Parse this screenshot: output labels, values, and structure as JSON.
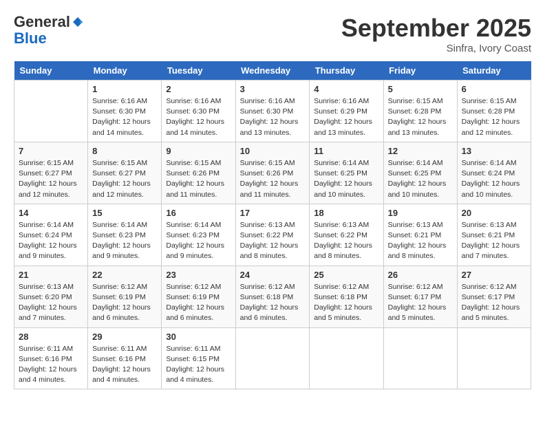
{
  "header": {
    "logo_general": "General",
    "logo_blue": "Blue",
    "month_title": "September 2025",
    "subtitle": "Sinfra, Ivory Coast"
  },
  "weekdays": [
    "Sunday",
    "Monday",
    "Tuesday",
    "Wednesday",
    "Thursday",
    "Friday",
    "Saturday"
  ],
  "weeks": [
    [
      {
        "day": "",
        "info": ""
      },
      {
        "day": "1",
        "info": "Sunrise: 6:16 AM\nSunset: 6:30 PM\nDaylight: 12 hours\nand 14 minutes."
      },
      {
        "day": "2",
        "info": "Sunrise: 6:16 AM\nSunset: 6:30 PM\nDaylight: 12 hours\nand 14 minutes."
      },
      {
        "day": "3",
        "info": "Sunrise: 6:16 AM\nSunset: 6:30 PM\nDaylight: 12 hours\nand 13 minutes."
      },
      {
        "day": "4",
        "info": "Sunrise: 6:16 AM\nSunset: 6:29 PM\nDaylight: 12 hours\nand 13 minutes."
      },
      {
        "day": "5",
        "info": "Sunrise: 6:15 AM\nSunset: 6:28 PM\nDaylight: 12 hours\nand 13 minutes."
      },
      {
        "day": "6",
        "info": "Sunrise: 6:15 AM\nSunset: 6:28 PM\nDaylight: 12 hours\nand 12 minutes."
      }
    ],
    [
      {
        "day": "7",
        "info": "Sunrise: 6:15 AM\nSunset: 6:27 PM\nDaylight: 12 hours\nand 12 minutes."
      },
      {
        "day": "8",
        "info": "Sunrise: 6:15 AM\nSunset: 6:27 PM\nDaylight: 12 hours\nand 12 minutes."
      },
      {
        "day": "9",
        "info": "Sunrise: 6:15 AM\nSunset: 6:26 PM\nDaylight: 12 hours\nand 11 minutes."
      },
      {
        "day": "10",
        "info": "Sunrise: 6:15 AM\nSunset: 6:26 PM\nDaylight: 12 hours\nand 11 minutes."
      },
      {
        "day": "11",
        "info": "Sunrise: 6:14 AM\nSunset: 6:25 PM\nDaylight: 12 hours\nand 10 minutes."
      },
      {
        "day": "12",
        "info": "Sunrise: 6:14 AM\nSunset: 6:25 PM\nDaylight: 12 hours\nand 10 minutes."
      },
      {
        "day": "13",
        "info": "Sunrise: 6:14 AM\nSunset: 6:24 PM\nDaylight: 12 hours\nand 10 minutes."
      }
    ],
    [
      {
        "day": "14",
        "info": "Sunrise: 6:14 AM\nSunset: 6:24 PM\nDaylight: 12 hours\nand 9 minutes."
      },
      {
        "day": "15",
        "info": "Sunrise: 6:14 AM\nSunset: 6:23 PM\nDaylight: 12 hours\nand 9 minutes."
      },
      {
        "day": "16",
        "info": "Sunrise: 6:14 AM\nSunset: 6:23 PM\nDaylight: 12 hours\nand 9 minutes."
      },
      {
        "day": "17",
        "info": "Sunrise: 6:13 AM\nSunset: 6:22 PM\nDaylight: 12 hours\nand 8 minutes."
      },
      {
        "day": "18",
        "info": "Sunrise: 6:13 AM\nSunset: 6:22 PM\nDaylight: 12 hours\nand 8 minutes."
      },
      {
        "day": "19",
        "info": "Sunrise: 6:13 AM\nSunset: 6:21 PM\nDaylight: 12 hours\nand 8 minutes."
      },
      {
        "day": "20",
        "info": "Sunrise: 6:13 AM\nSunset: 6:21 PM\nDaylight: 12 hours\nand 7 minutes."
      }
    ],
    [
      {
        "day": "21",
        "info": "Sunrise: 6:13 AM\nSunset: 6:20 PM\nDaylight: 12 hours\nand 7 minutes."
      },
      {
        "day": "22",
        "info": "Sunrise: 6:12 AM\nSunset: 6:19 PM\nDaylight: 12 hours\nand 6 minutes."
      },
      {
        "day": "23",
        "info": "Sunrise: 6:12 AM\nSunset: 6:19 PM\nDaylight: 12 hours\nand 6 minutes."
      },
      {
        "day": "24",
        "info": "Sunrise: 6:12 AM\nSunset: 6:18 PM\nDaylight: 12 hours\nand 6 minutes."
      },
      {
        "day": "25",
        "info": "Sunrise: 6:12 AM\nSunset: 6:18 PM\nDaylight: 12 hours\nand 5 minutes."
      },
      {
        "day": "26",
        "info": "Sunrise: 6:12 AM\nSunset: 6:17 PM\nDaylight: 12 hours\nand 5 minutes."
      },
      {
        "day": "27",
        "info": "Sunrise: 6:12 AM\nSunset: 6:17 PM\nDaylight: 12 hours\nand 5 minutes."
      }
    ],
    [
      {
        "day": "28",
        "info": "Sunrise: 6:11 AM\nSunset: 6:16 PM\nDaylight: 12 hours\nand 4 minutes."
      },
      {
        "day": "29",
        "info": "Sunrise: 6:11 AM\nSunset: 6:16 PM\nDaylight: 12 hours\nand 4 minutes."
      },
      {
        "day": "30",
        "info": "Sunrise: 6:11 AM\nSunset: 6:15 PM\nDaylight: 12 hours\nand 4 minutes."
      },
      {
        "day": "",
        "info": ""
      },
      {
        "day": "",
        "info": ""
      },
      {
        "day": "",
        "info": ""
      },
      {
        "day": "",
        "info": ""
      }
    ]
  ]
}
